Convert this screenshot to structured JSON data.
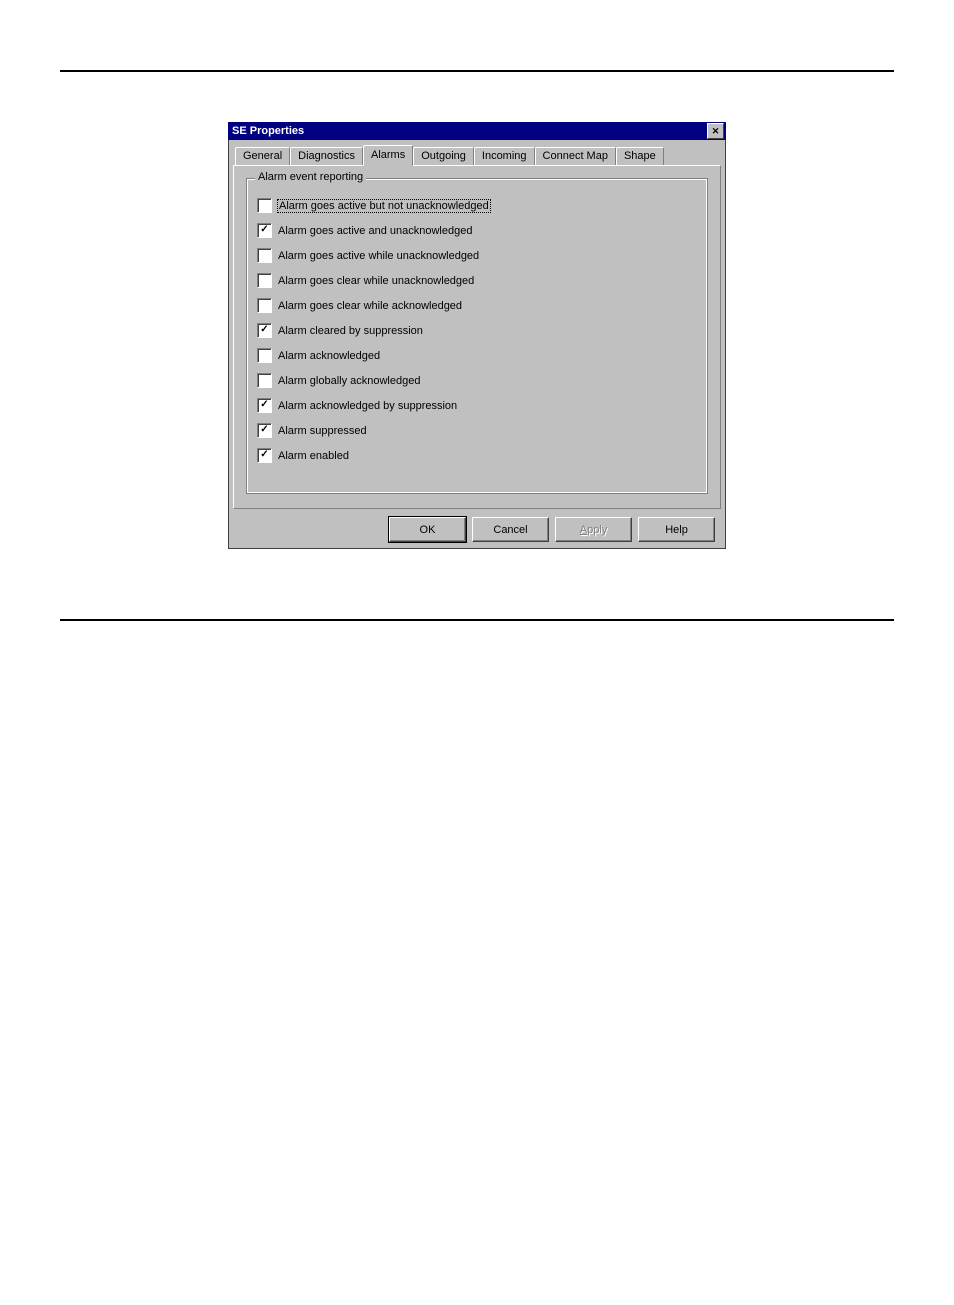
{
  "window": {
    "title": "SE Properties",
    "close_icon": "x"
  },
  "tabs": [
    {
      "label": "General",
      "active": false
    },
    {
      "label": "Diagnostics",
      "active": false
    },
    {
      "label": "Alarms",
      "active": true
    },
    {
      "label": "Outgoing",
      "active": false
    },
    {
      "label": "Incoming",
      "active": false
    },
    {
      "label": "Connect Map",
      "active": false
    },
    {
      "label": "Shape",
      "active": false
    }
  ],
  "group": {
    "label": "Alarm event reporting",
    "items": [
      {
        "label": "Alarm goes active but not unacknowledged",
        "checked": false,
        "focused": true
      },
      {
        "label": "Alarm goes active and unacknowledged",
        "checked": true,
        "focused": false
      },
      {
        "label": "Alarm goes active while unacknowledged",
        "checked": false,
        "focused": false
      },
      {
        "label": "Alarm goes clear while unacknowledged",
        "checked": false,
        "focused": false
      },
      {
        "label": "Alarm goes clear while acknowledged",
        "checked": false,
        "focused": false
      },
      {
        "label": "Alarm cleared by suppression",
        "checked": true,
        "focused": false
      },
      {
        "label": "Alarm acknowledged",
        "checked": false,
        "focused": false
      },
      {
        "label": "Alarm globally acknowledged",
        "checked": false,
        "focused": false
      },
      {
        "label": "Alarm acknowledged by suppression",
        "checked": true,
        "focused": false
      },
      {
        "label": "Alarm suppressed",
        "checked": true,
        "focused": false
      },
      {
        "label": "Alarm enabled",
        "checked": true,
        "focused": false
      }
    ]
  },
  "buttons": {
    "ok": "OK",
    "cancel": "Cancel",
    "apply": "Apply",
    "help": "Help"
  }
}
